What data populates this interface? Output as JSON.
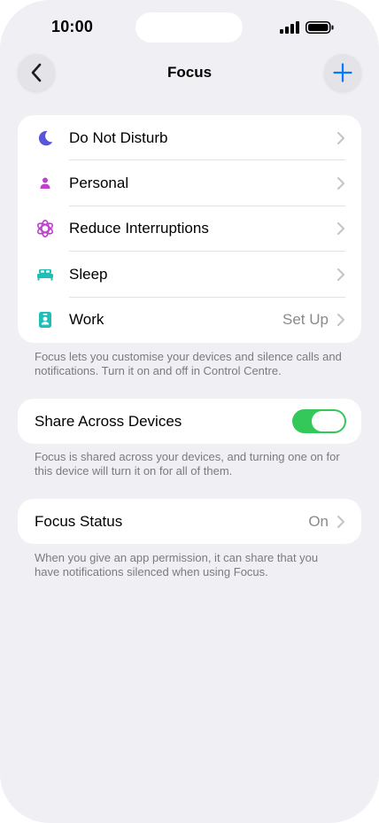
{
  "status_bar": {
    "time": "10:00"
  },
  "nav": {
    "title": "Focus",
    "back_icon": "chevron-left-icon",
    "add_icon": "plus-icon"
  },
  "focus_modes": [
    {
      "label": "Do Not Disturb",
      "icon": "moon-icon",
      "color": "#5856d6",
      "detail": ""
    },
    {
      "label": "Personal",
      "icon": "person-icon",
      "color": "#bf3fcf",
      "detail": ""
    },
    {
      "label": "Reduce Interruptions",
      "icon": "interruptions-icon",
      "color": "#bf3fcf",
      "detail": ""
    },
    {
      "label": "Sleep",
      "icon": "bed-icon",
      "color": "#1fbfb8",
      "detail": ""
    },
    {
      "label": "Work",
      "icon": "badge-icon",
      "color": "#1fbfb8",
      "detail": "Set Up"
    }
  ],
  "focus_footnote": "Focus lets you customise your devices and silence calls and notifications. Turn it on and off in Control Centre.",
  "share": {
    "label": "Share Across Devices",
    "enabled": true,
    "toggle_color": "#34c759",
    "footnote": "Focus is shared across your devices, and turning one on for this device will turn it on for all of them."
  },
  "focus_status": {
    "label": "Focus Status",
    "value": "On",
    "footnote": "When you give an app permission, it can share that you have notifications silenced when using Focus."
  },
  "colors": {
    "accent": "#007aff",
    "background": "#efeff4"
  }
}
